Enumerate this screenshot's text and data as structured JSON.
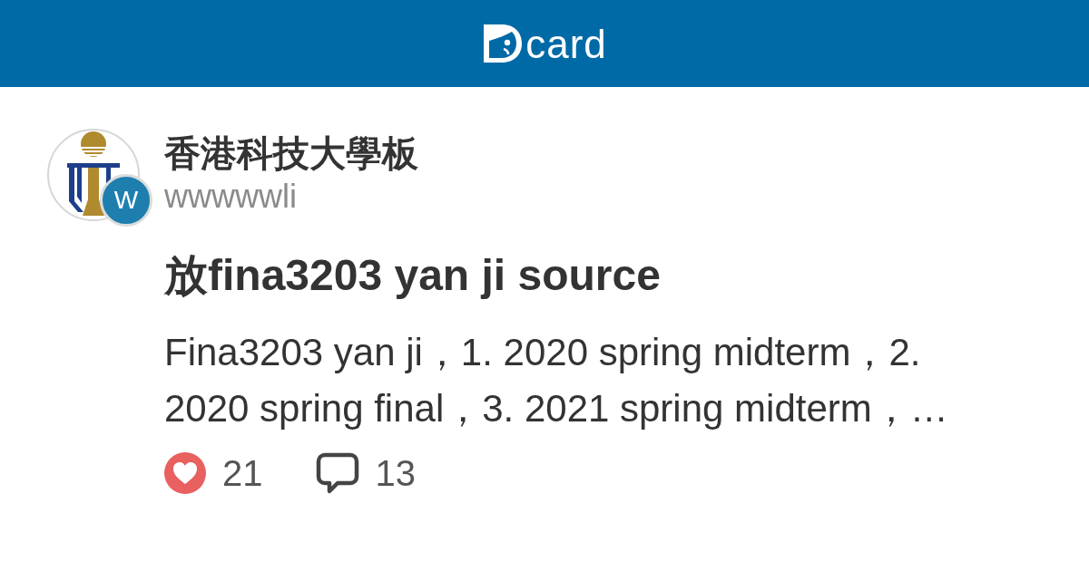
{
  "header": {
    "logo_text": "card"
  },
  "post": {
    "forum": {
      "name": "香港科技大學板"
    },
    "author": {
      "initial": "W",
      "name": "wwwwwli"
    },
    "title": "放fina3203 yan ji source",
    "excerpt": "Fina3203 yan ji，1. 2020 spring midterm，2. 2020 spring final，3. 2021 spring midterm，…",
    "stats": {
      "likes": "21",
      "comments": "13"
    }
  }
}
